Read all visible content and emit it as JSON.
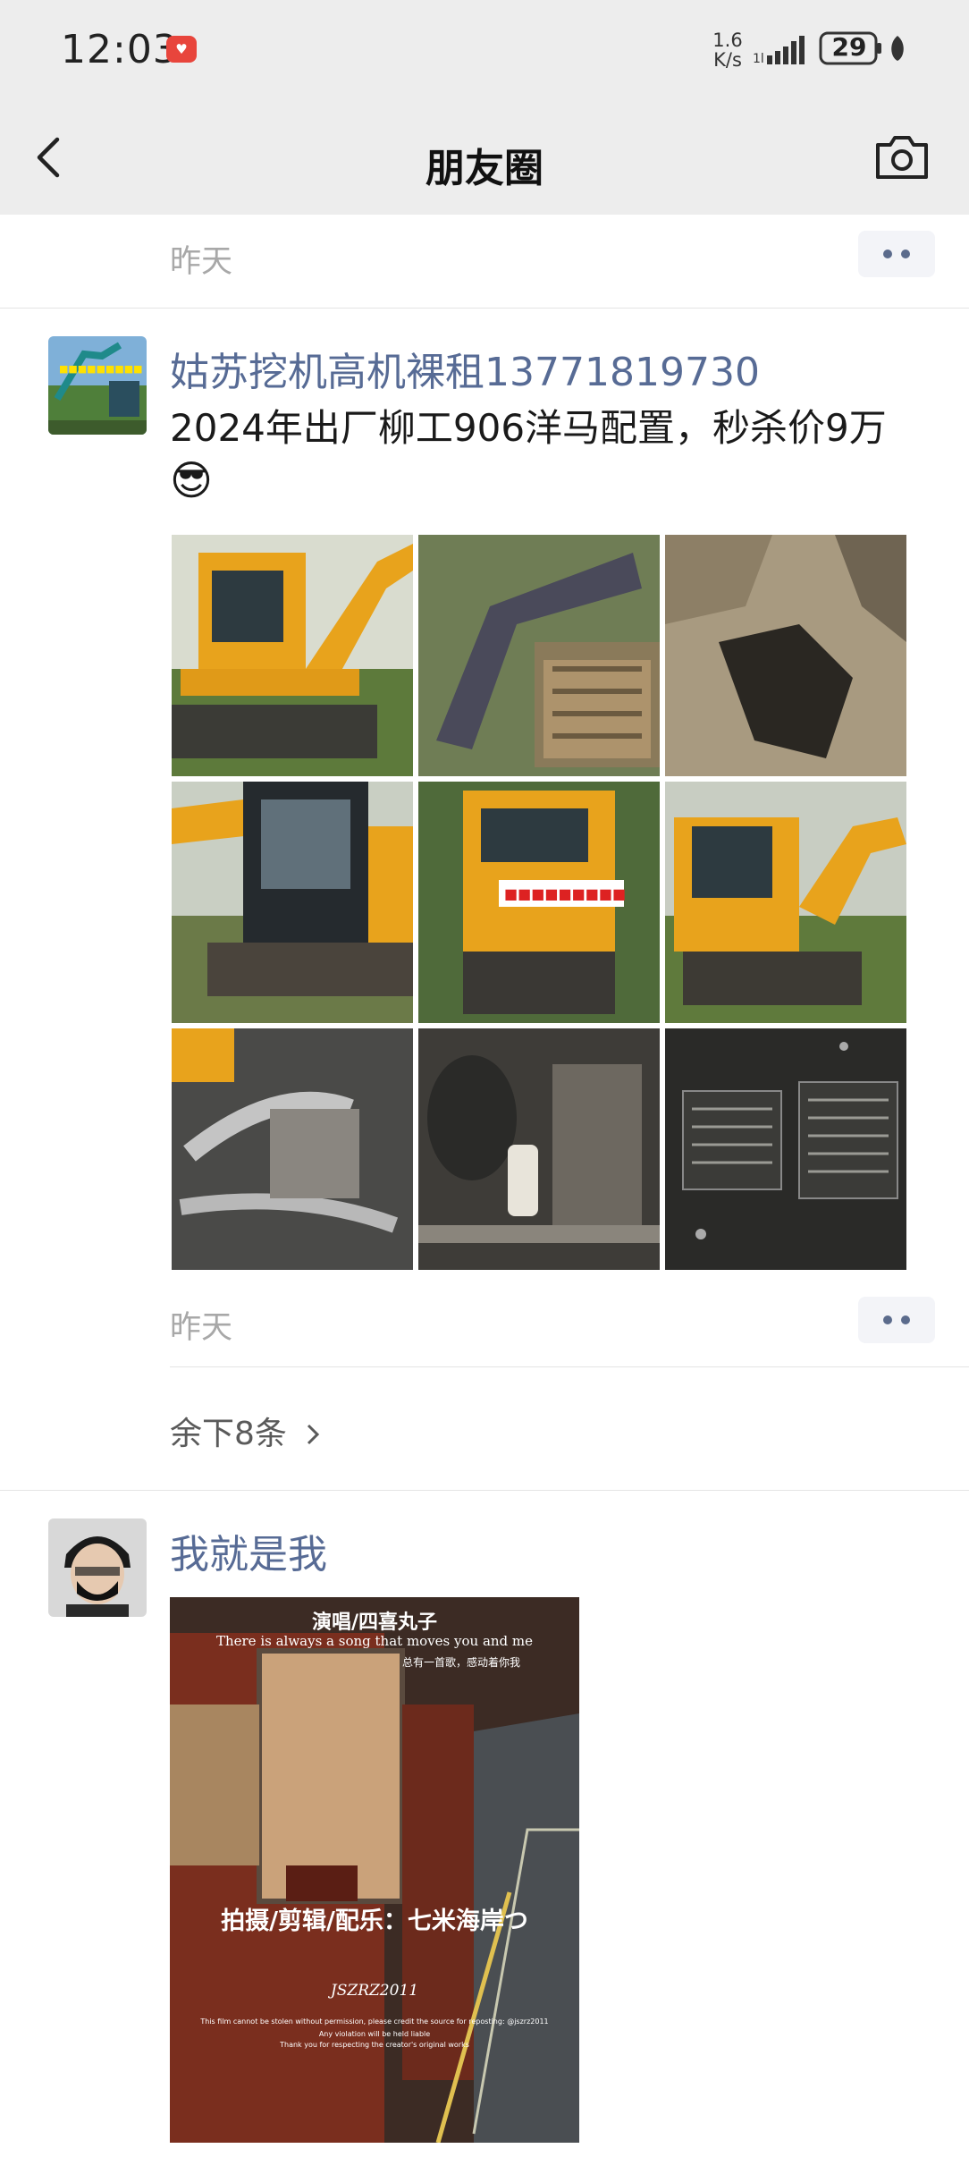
{
  "status_bar": {
    "time": "12:03",
    "network_speed_value": "1.6",
    "network_speed_unit": "K/s",
    "battery": "29"
  },
  "nav": {
    "title": "朋友圈",
    "back_icon": "chevron-left-icon",
    "camera_icon": "camera-icon"
  },
  "posts": [
    {
      "time": "昨天"
    },
    {
      "author": "姑苏挖机高机裸租13771819730",
      "text": "2024年出厂柳工906洋马配置，秒杀价9万",
      "emoji": "😎",
      "photo_count": 9,
      "time": "昨天",
      "remaining_label": "余下8条"
    },
    {
      "author": "我就是我",
      "video": {
        "line1": "演唱/四喜丸子",
        "line2": "There is always a song that moves you and me",
        "line3": "总有一首歌，感动着你我",
        "credit": "拍摄/剪辑/配乐：七米海岸つ",
        "signature": "JSZRZ2011",
        "notice1": "This film cannot be stolen without permission, please credit the source for reposting: @jszrz2011",
        "notice2": "Any violation will be held liable",
        "notice3": "Thank you for respecting the creator's original works"
      }
    }
  ],
  "colors": {
    "link": "#576b95",
    "header_bg": "#ededed",
    "secondary_text": "#a8a8a8"
  }
}
